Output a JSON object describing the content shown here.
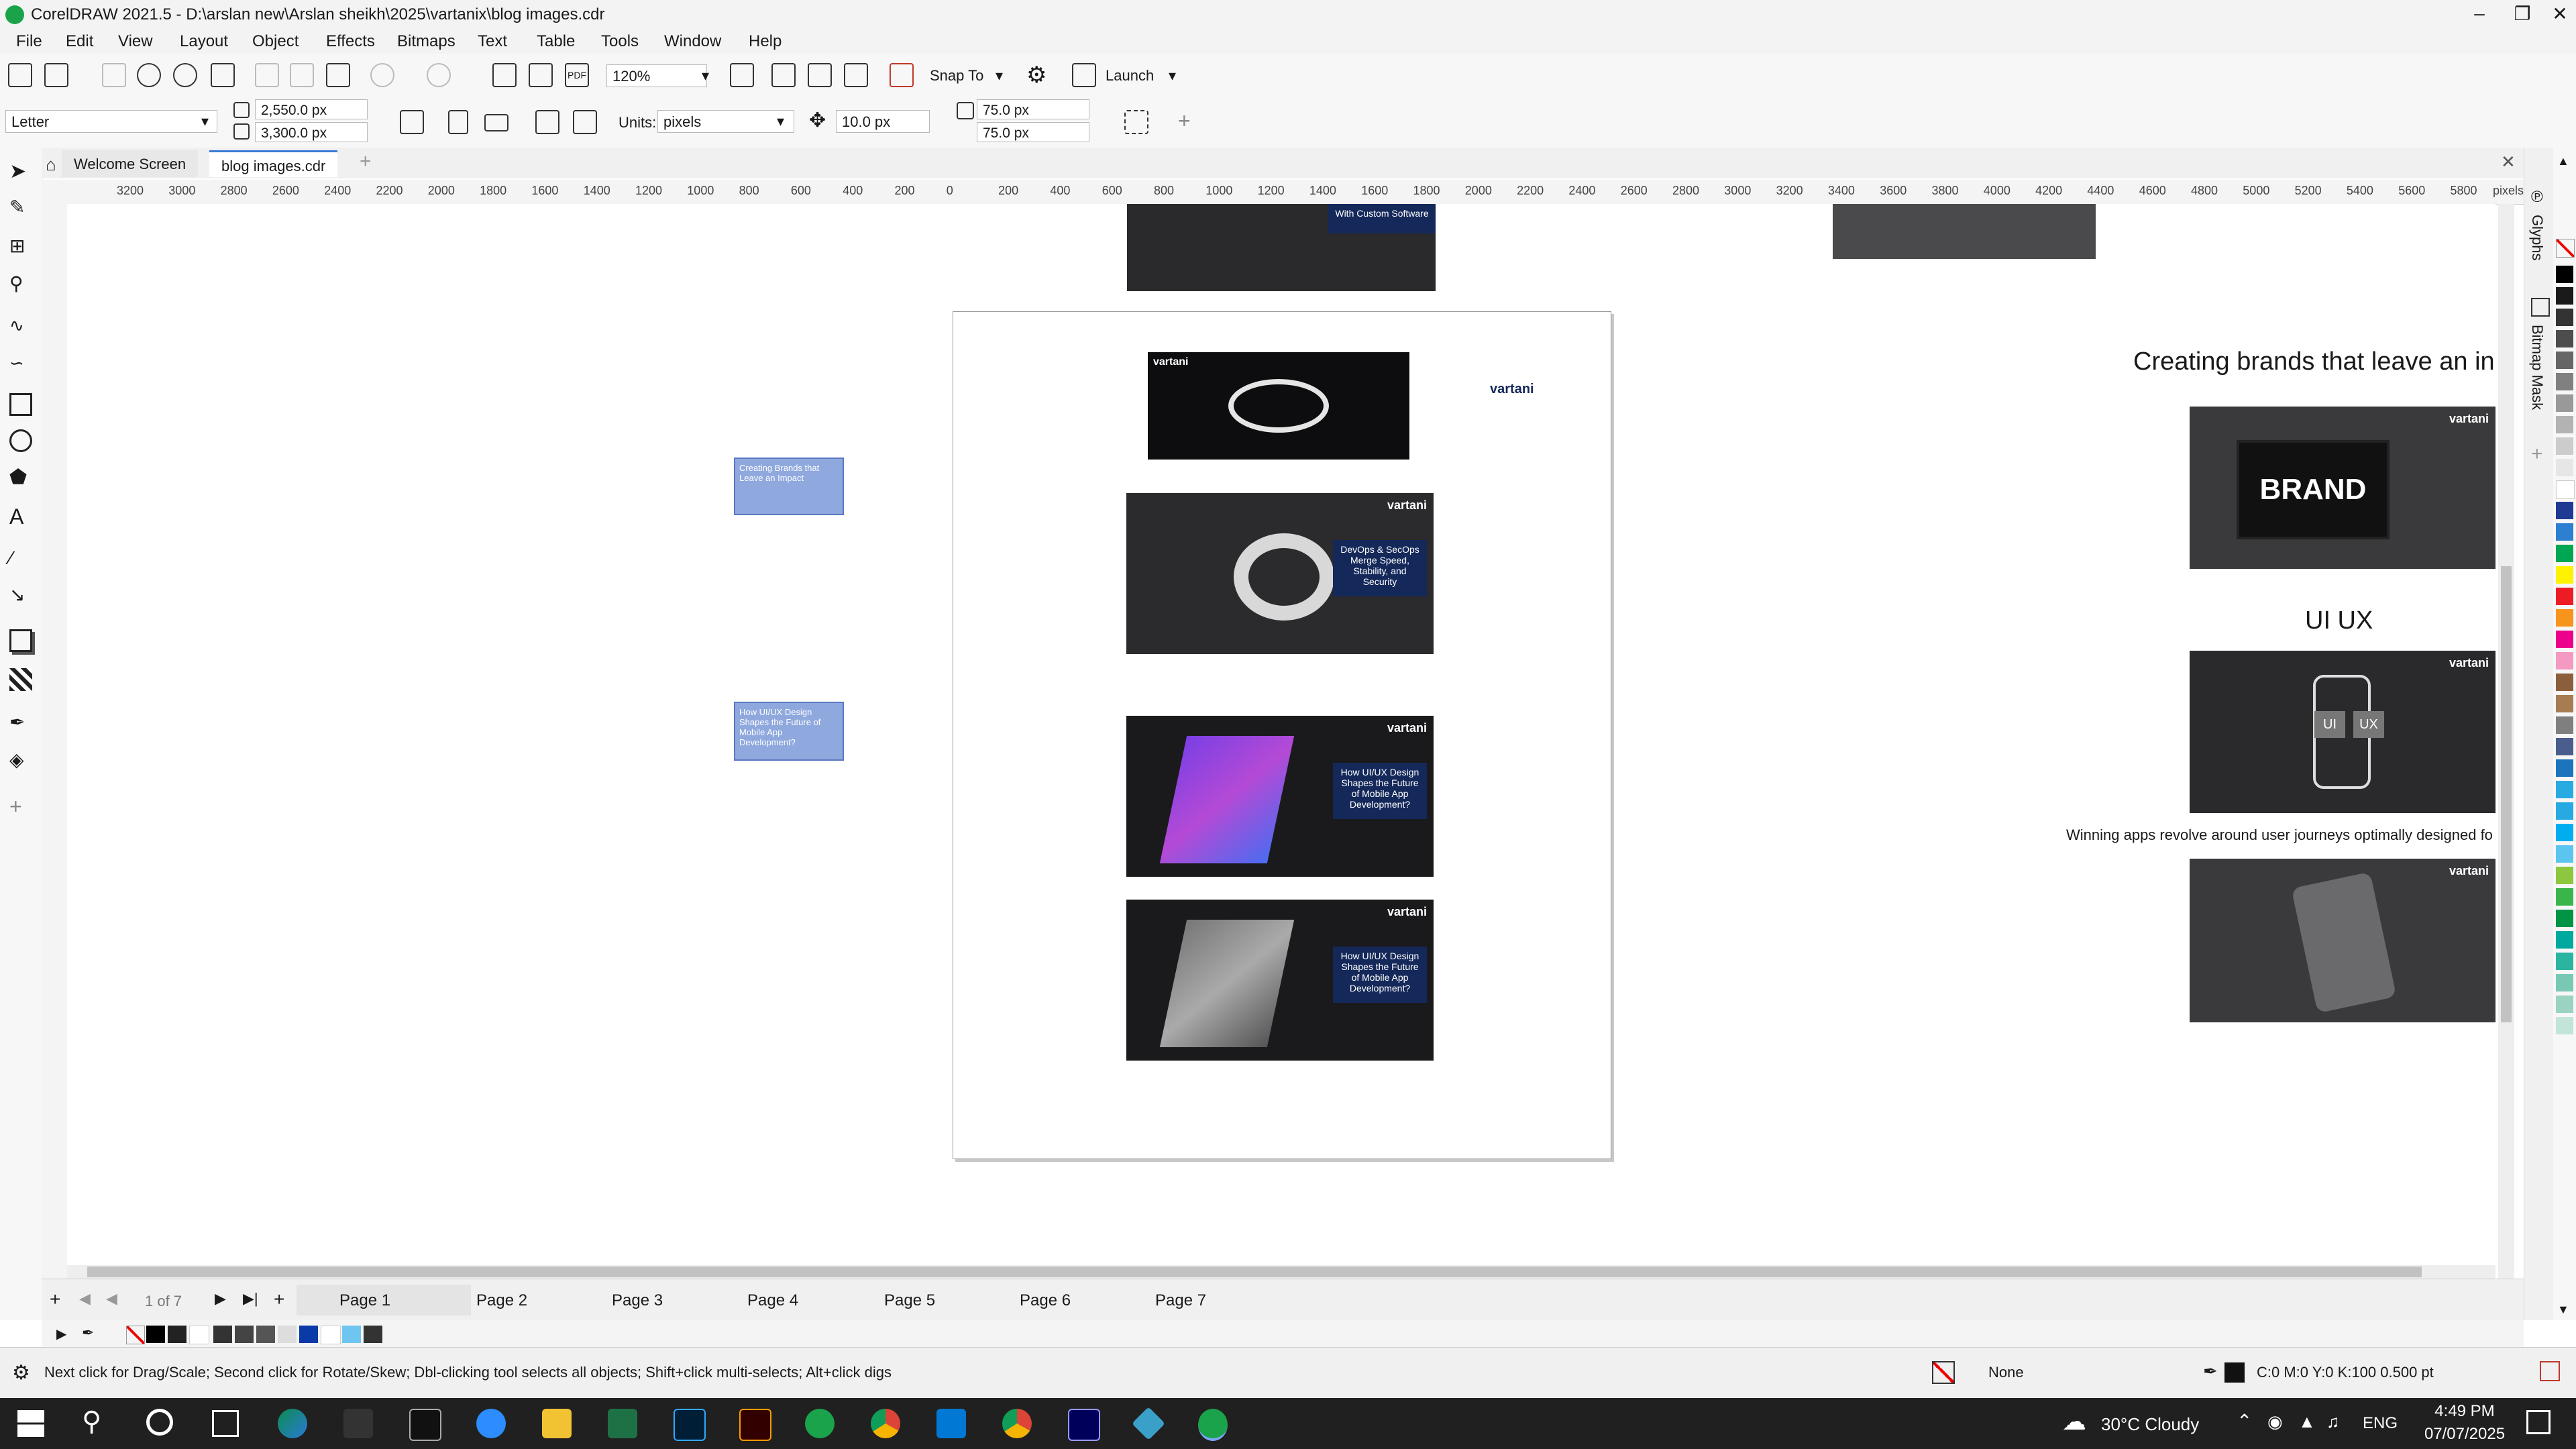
{
  "window": {
    "title": "CorelDRAW 2021.5 - D:\\arslan new\\Arslan sheikh\\2025\\vartanix\\blog images.cdr"
  },
  "menu": [
    "File",
    "Edit",
    "View",
    "Layout",
    "Object",
    "Effects",
    "Bitmaps",
    "Text",
    "Table",
    "Tools",
    "Window",
    "Help"
  ],
  "toolbar": {
    "zoom": "120%",
    "snap_to": "Snap To",
    "launch": "Launch"
  },
  "property_bar": {
    "page_size": "Letter",
    "width": "2,550.0 px",
    "height": "3,300.0 px",
    "units_label": "Units:",
    "units_value": "pixels",
    "nudge": "10.0 px",
    "dup_x": "75.0 px",
    "dup_y": "75.0 px"
  },
  "tabs": [
    {
      "label": "Welcome Screen"
    },
    {
      "label": "blog images.cdr"
    }
  ],
  "ruler": {
    "h_ticks": [
      "3200",
      "3000",
      "2800",
      "2600",
      "2400",
      "2200",
      "2000",
      "1800",
      "1600",
      "1400",
      "1200",
      "1000",
      "800",
      "600",
      "400",
      "200",
      "0",
      "200",
      "400",
      "600",
      "800",
      "1000",
      "1200",
      "1400",
      "1600",
      "1800",
      "2000",
      "2200",
      "2400",
      "2600",
      "2800",
      "3000",
      "3200",
      "3400",
      "3600",
      "3800",
      "4000",
      "4200",
      "4400",
      "4600",
      "4800",
      "5000",
      "5200",
      "5400",
      "5600",
      "5800"
    ],
    "units": "pixels"
  },
  "canvas": {
    "logo": "vartani",
    "frame1": "Creating Brands that Leave an Impact",
    "frame2": "How UI/UX Design Shapes the Future of Mobile App Development?",
    "top_thumb_caption": "With Custom Software",
    "devops_caption": "DevOps & SecOps Merge Speed, Stability, and Security",
    "uiux_caption": "How UI/UX Design Shapes the Future of Mobile App Development?",
    "heading_brands": "Creating brands that leave an in",
    "heading_uiux": "UI UX",
    "winning_text": "Winning apps revolve around user journeys optimally designed fo",
    "brand_word": "BRAND",
    "ui_label": "UI",
    "ux_label": "UX"
  },
  "dockers": [
    "Glyphs",
    "Bitmap Mask"
  ],
  "pages": {
    "counter": "1 of 7",
    "tabs": [
      "Page 1",
      "Page 2",
      "Page 3",
      "Page 4",
      "Page 5",
      "Page 6",
      "Page 7"
    ],
    "active": "Page 1"
  },
  "status": {
    "hint": "Next click for Drag/Scale; Second click for Rotate/Skew; Dbl-clicking tool selects all objects; Shift+click multi-selects; Alt+click digs",
    "fill": "None",
    "outline": "C:0 M:0 Y:0 K:100  0.500 pt"
  },
  "taskbar": {
    "weather": "30°C  Cloudy",
    "lang": "ENG",
    "time": "4:49 PM",
    "date": "07/07/2025"
  },
  "colors": {
    "accent": "#1aa34a",
    "selection_blue": "#8fa8de",
    "panel_navy": "#14285a",
    "palette": [
      "#000000",
      "#1a1a1a",
      "#333333",
      "#4d4d4d",
      "#666666",
      "#808080",
      "#999999",
      "#b3b3b3",
      "#cccccc",
      "#e6e6e6",
      "#ffffff",
      "#1f3a93",
      "#2d7fd1",
      "#00a651",
      "#fff200",
      "#ed1c24",
      "#f7941d",
      "#ec008c",
      "#f49ac2",
      "#8b5e3c",
      "#a67c52",
      "#7f7f7f",
      "#4b5d8c",
      "#1b75bc",
      "#29abe2",
      "#27aae1",
      "#00aeef",
      "#5cc5ef",
      "#8dc63f",
      "#39b54a",
      "#009444",
      "#00a99d",
      "#2bb5a0",
      "#79c8b4",
      "#9bd3c3",
      "#c2e4d9"
    ]
  }
}
